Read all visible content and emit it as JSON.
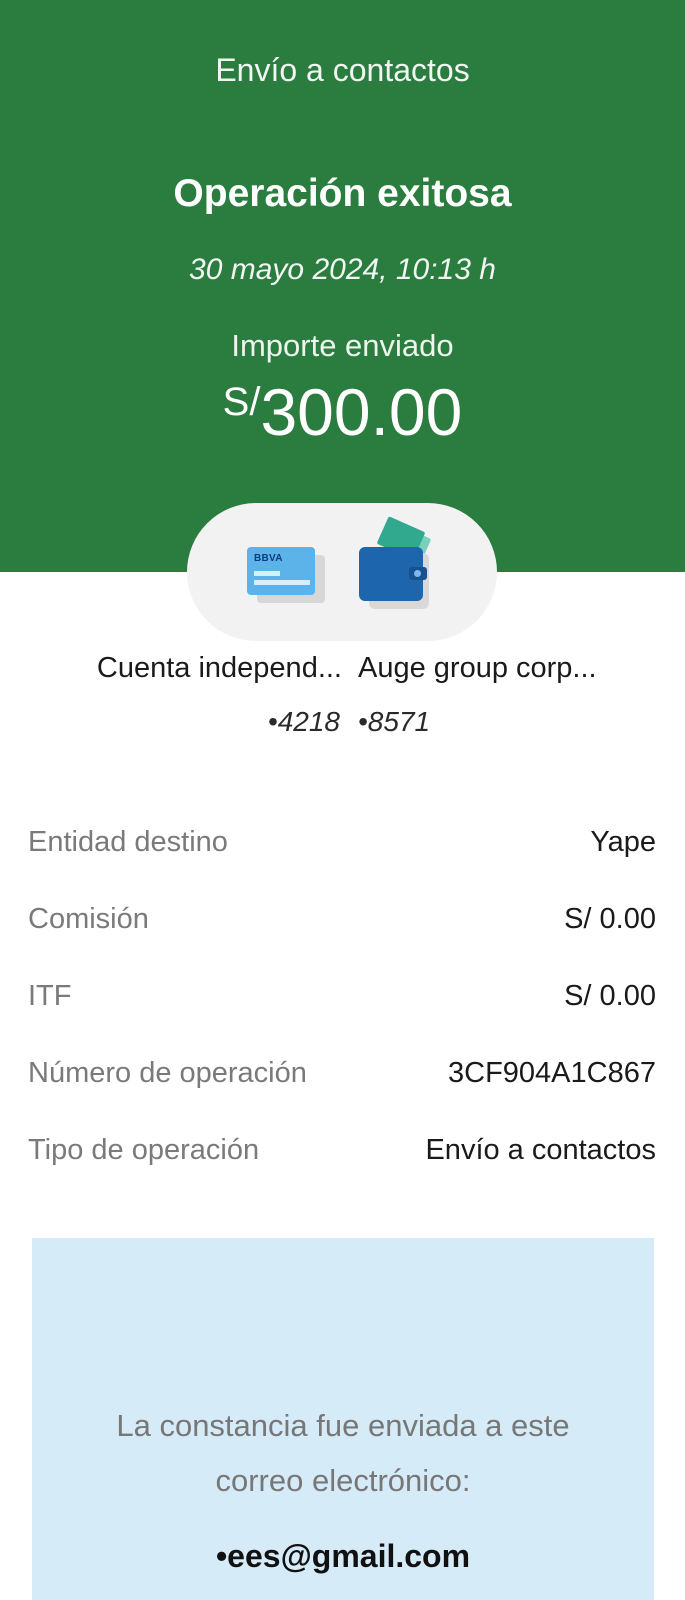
{
  "header": {
    "screen_title": "Envío a contactos",
    "status_title": "Operación exitosa",
    "datetime": "30 mayo 2024,  10:13 h",
    "amount_label": "Importe enviado",
    "currency_symbol": "S/",
    "amount_value": "300.00",
    "background_color": "#2a7d3f"
  },
  "transfer": {
    "origin": {
      "icon": "card-icon",
      "card_brand": "BBVA",
      "name": "Cuenta independ...",
      "number": "•4218"
    },
    "destination": {
      "icon": "wallet-icon",
      "name": "Auge group corp...",
      "number": "•8571"
    }
  },
  "details": [
    {
      "label": "Entidad destino",
      "value": "Yape"
    },
    {
      "label": "Comisión",
      "value": "S/ 0.00"
    },
    {
      "label": "ITF",
      "value": "S/ 0.00"
    },
    {
      "label": "Número de operación",
      "value": "3CF904A1C867"
    },
    {
      "label": "Tipo de operación",
      "value": "Envío a contactos"
    }
  ],
  "notice": {
    "text": "La constancia fue enviada a este correo electrónico:",
    "email": "•ees@gmail.com",
    "background_color": "#d6ebf8"
  }
}
